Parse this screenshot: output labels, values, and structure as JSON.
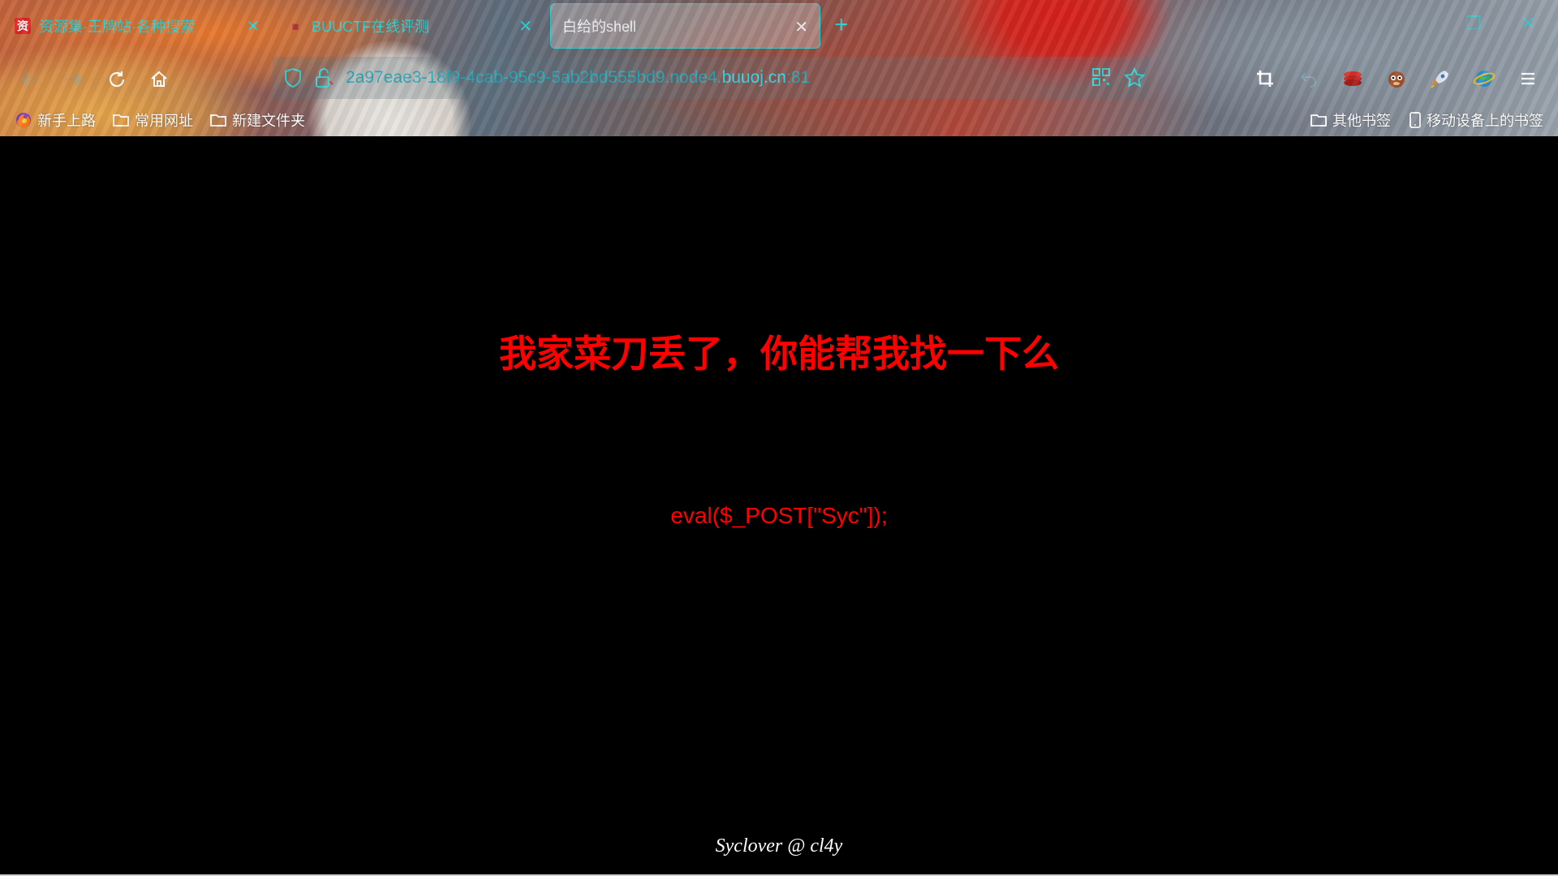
{
  "tabs": [
    {
      "title": "资源集·王牌站·各种搜索",
      "favicon": "red-square-favicon",
      "active": false
    },
    {
      "title": "BUUCTF在线评测",
      "favicon": "buuctf-favicon",
      "active": false
    },
    {
      "title": "白给的shell",
      "favicon": "",
      "active": true
    }
  ],
  "new_tab_label": "+",
  "url": {
    "prefix": "2a97eae3-18f9-4cab-95c9-5ab2bd555bd9.node4.",
    "host": "buuoj.cn",
    "port": ":81"
  },
  "bookmarks_left": [
    {
      "label": "新手上路",
      "icon": "firefox-icon"
    },
    {
      "label": "常用网址",
      "icon": "folder-icon"
    },
    {
      "label": "新建文件夹",
      "icon": "folder-icon"
    }
  ],
  "bookmarks_right": [
    {
      "label": "其他书签",
      "icon": "folder-icon"
    },
    {
      "label": "移动设备上的书签",
      "icon": "mobile-icon"
    }
  ],
  "page": {
    "heading": "我家菜刀丢了，你能帮我找一下么",
    "code": "eval($_POST[\"Syc\"]);",
    "footer": "Syclover @ cl4y"
  },
  "colors": {
    "accent": "#2fd0d0",
    "page_text": "#ff0000",
    "page_bg": "#000000",
    "footer_text": "#ffffff"
  }
}
